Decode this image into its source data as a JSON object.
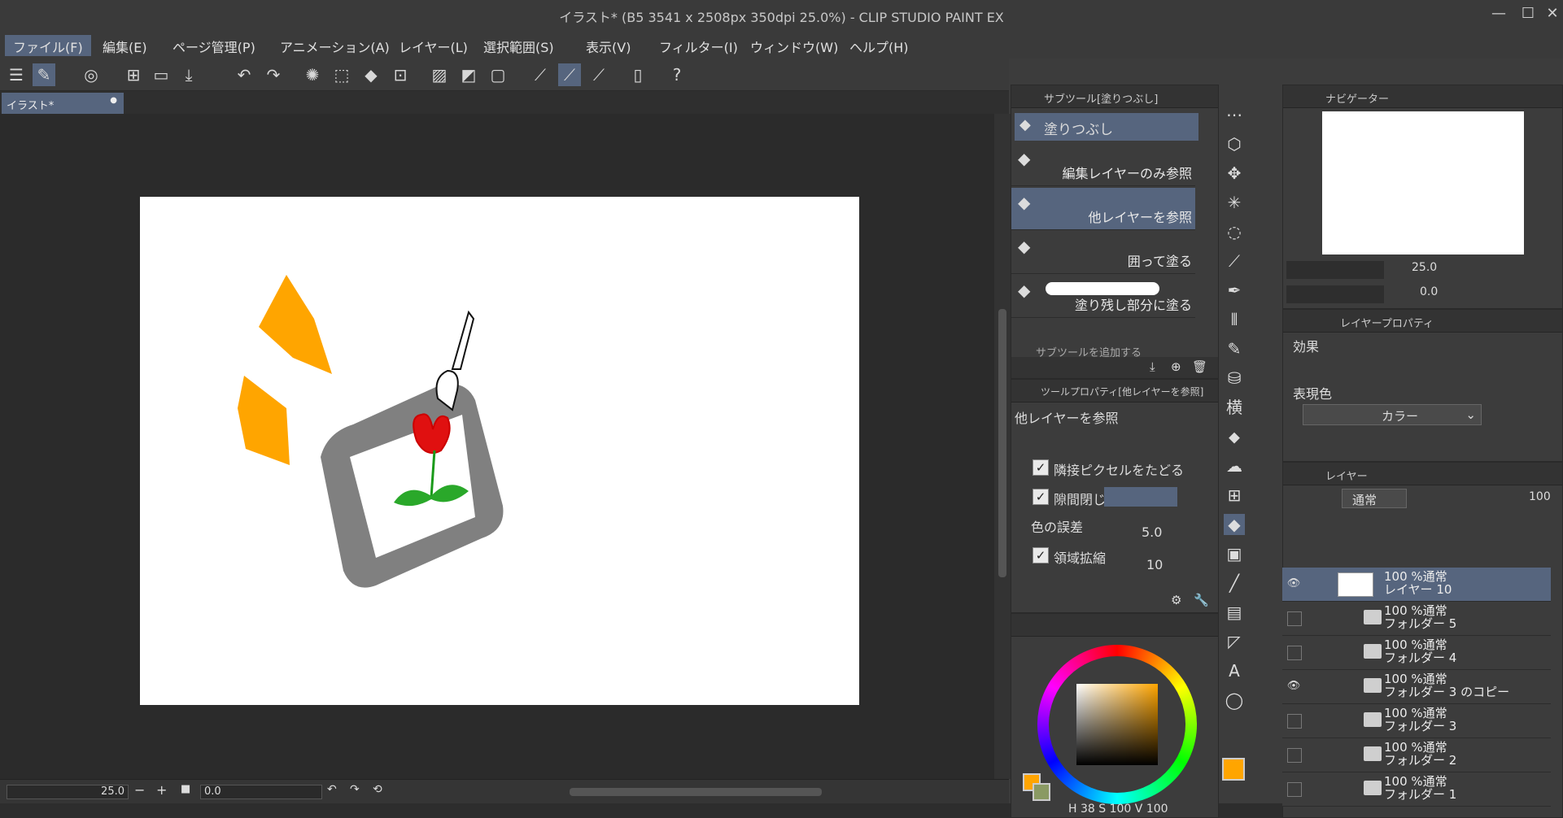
{
  "window": {
    "title": "イラスト* (B5 3541 x 2508px 350dpi 25.0%)  - CLIP STUDIO PAINT EX",
    "minimize_icon": "minimize-icon",
    "maximize_icon": "maximize-icon",
    "close_icon": "close-icon"
  },
  "menu": [
    {
      "label": "ファイル(F)"
    },
    {
      "label": "編集(E)"
    },
    {
      "label": "ページ管理(P)"
    },
    {
      "label": "アニメーション(A)"
    },
    {
      "label": "レイヤー(L)"
    },
    {
      "label": "選択範囲(S)"
    },
    {
      "label": "表示(V)"
    },
    {
      "label": "フィルター(I)"
    },
    {
      "label": "ウィンドウ(W)"
    },
    {
      "label": "ヘルプ(H)"
    }
  ],
  "document_tab": {
    "label": "イラスト*"
  },
  "subtool_panel": {
    "title": "サブツール[塗りつぶし]",
    "group_label": "塗りつぶし",
    "items": [
      {
        "label": "編集レイヤーのみ参照"
      },
      {
        "label": "他レイヤーを参照"
      },
      {
        "label": "囲って塗る"
      },
      {
        "label": "塗り残し部分に塗る"
      }
    ],
    "add_label": "サブツールを追加する"
  },
  "tool_property": {
    "title": "ツールプロパティ[他レイヤーを参照]",
    "name": "他レイヤーを参照",
    "follow_adjacent": "隣接ピクセルをたどる",
    "close_gap": "隙間閉じ",
    "color_margin_label": "色の誤差",
    "color_margin_value": "5.0",
    "area_scaling_label": "領域拡縮",
    "area_scaling_value": "10"
  },
  "color_panel": {
    "main_color": "#FFA500",
    "sub_color": "#8a9a63",
    "h": "38",
    "s": "100",
    "v": "100"
  },
  "navigator": {
    "title": "ナビゲーター",
    "zoom": "25.0",
    "rotation": "0.0"
  },
  "layer_property": {
    "title": "レイヤープロパティ",
    "effect_label": "効果",
    "expression_label": "表現色",
    "expression_value": "カラー"
  },
  "layer_panel": {
    "title": "レイヤー",
    "blend_mode": "通常",
    "opacity": "100",
    "layers": [
      {
        "percent_mode": "100 %通常",
        "name": "レイヤー 10",
        "visible": true,
        "type": "layer"
      },
      {
        "percent_mode": "100 %通常",
        "name": "フォルダー 5",
        "visible": false,
        "type": "folder"
      },
      {
        "percent_mode": "100 %通常",
        "name": "フォルダー 4",
        "visible": false,
        "type": "folder"
      },
      {
        "percent_mode": "100 %通常",
        "name": "フォルダー 3 のコピー",
        "visible": true,
        "type": "folder"
      },
      {
        "percent_mode": "100 %通常",
        "name": "フォルダー 3",
        "visible": false,
        "type": "folder"
      },
      {
        "percent_mode": "100 %通常",
        "name": "フォルダー 2",
        "visible": false,
        "type": "folder"
      },
      {
        "percent_mode": "100 %通常",
        "name": "フォルダー 1",
        "visible": false,
        "type": "folder"
      }
    ]
  },
  "status": {
    "zoom": "25.0",
    "rotation": "0.0"
  }
}
